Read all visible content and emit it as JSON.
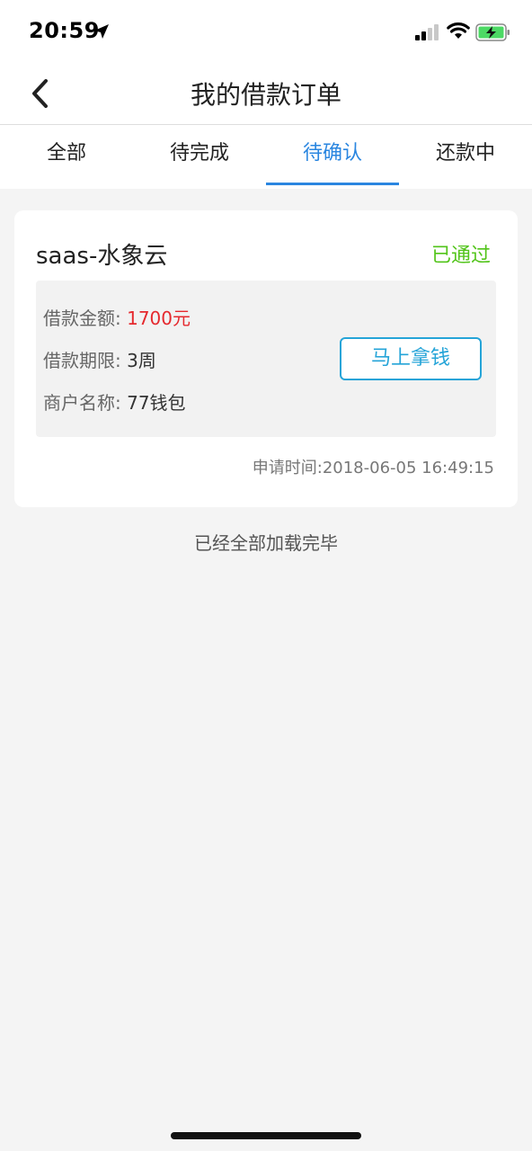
{
  "status_bar": {
    "time": "20:59",
    "icons": [
      "location-arrow-icon",
      "cellular-signal-icon",
      "wifi-icon",
      "battery-charging-icon"
    ]
  },
  "nav": {
    "title": "我的借款订单",
    "back_icon": "chevron-left-icon"
  },
  "tabs": [
    {
      "label": "全部",
      "active": false
    },
    {
      "label": "待完成",
      "active": false
    },
    {
      "label": "待确认",
      "active": true
    },
    {
      "label": "还款中",
      "active": false
    }
  ],
  "colors": {
    "accent": "#2a86e0",
    "status_approved": "#52c41a",
    "amount": "#e5292e",
    "button": "#25a4d8"
  },
  "order": {
    "merchant_title": "saas-水象云",
    "status": "已通过",
    "amount_label": "借款金额:",
    "amount_value": "1700元",
    "term_label": "借款期限:",
    "term_value": "3周",
    "merchant_label": "商户名称:",
    "merchant_value": "77钱包",
    "action_label": "马上拿钱",
    "apply_time": "申请时间:2018-06-05 16:49:15"
  },
  "footer": {
    "load_complete": "已经全部加载完毕"
  }
}
